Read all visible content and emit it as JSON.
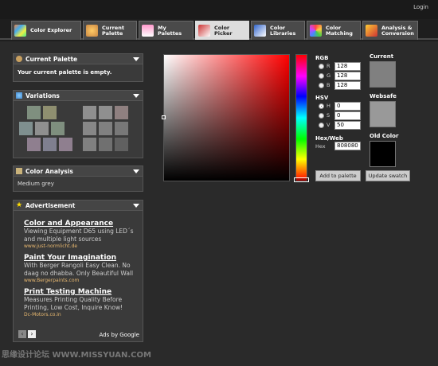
{
  "login": "Login",
  "tabs": [
    {
      "label": "Color Explorer",
      "icon": "color-explorer-icon"
    },
    {
      "label": "Current\nPalette",
      "icon": "palette-icon"
    },
    {
      "label": "My\nPalettes",
      "icon": "my-palettes-icon"
    },
    {
      "label": "Color\nPicker",
      "icon": "color-picker-icon",
      "active": true
    },
    {
      "label": "Color\nLibraries",
      "icon": "color-libraries-icon"
    },
    {
      "label": "Color\nMatching",
      "icon": "color-matching-icon"
    },
    {
      "label": "Analysis &\nConversion",
      "icon": "analysis-icon"
    }
  ],
  "current_palette": {
    "title": "Current Palette",
    "text": "Your current palette is empty."
  },
  "variations": {
    "title": "Variations",
    "left": [
      "#7f8f7f",
      "#8f8f70",
      "#7f8f8f",
      "#8f8f8f",
      "#7f8f7f",
      "#8f7f8f",
      "#7f7f8f",
      "#8f7f8f"
    ],
    "right": [
      "#8f8f8f",
      "#8f8f8f",
      "#8f8080",
      "#878787",
      "#808080",
      "#787878",
      "#808080",
      "#707070",
      "#606060"
    ]
  },
  "color_analysis": {
    "title": "Color Analysis",
    "text": "Medium grey"
  },
  "advertisement": {
    "title": "Advertisement",
    "ads": [
      {
        "title": "Color and Appearance",
        "desc": "Viewing Equipment D65 using LED´s and multiple light sources",
        "url": "www.just-normlicht.de"
      },
      {
        "title": "Paint Your Imagination",
        "desc": "With Berger Rangoli Easy Clean. No daag no dhabba. Only Beautiful Wall",
        "url": "www.Bergerpaints.com"
      },
      {
        "title": "Print Testing Machine",
        "desc": "Measures Printing Quality Before Printing, Low Cost, Inquire Know!",
        "url": "Dc-Motors.co.in"
      }
    ],
    "ads_by": "Ads by Google"
  },
  "picker": {
    "rgb_label": "RGB",
    "r_label": "R",
    "g_label": "G",
    "b_label": "B",
    "r": "128",
    "g": "128",
    "b": "128",
    "hsv_label": "HSV",
    "h_label": "H",
    "s_label": "S",
    "v_label": "V",
    "h": "0",
    "s": "0",
    "v": "50",
    "hex_label": "Hex/Web",
    "hex_sub": "Hex",
    "hex": "808080",
    "add_btn": "Add to palette",
    "update_btn": "Update swatch",
    "current_label": "Current",
    "websafe_label": "Websafe",
    "old_label": "Old Color",
    "current_color": "#808080",
    "websafe_color": "#999999",
    "old_color": "#000000"
  },
  "watermark": "思缘设计论坛 WWW.MISSYUAN.COM"
}
